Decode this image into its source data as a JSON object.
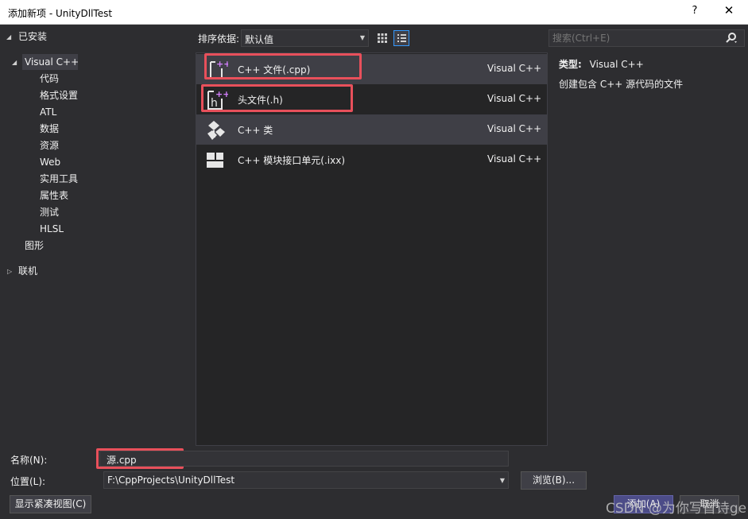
{
  "window": {
    "title": "添加新项 - UnityDllTest",
    "help_label": "?",
    "close_label": "✕"
  },
  "sidebar": {
    "installed_label": "已安装",
    "visual_cpp_label": "Visual C++",
    "children": [
      "代码",
      "格式设置",
      "ATL",
      "数据",
      "资源",
      "Web",
      "实用工具",
      "属性表",
      "测试",
      "HLSL"
    ],
    "graphics_label": "图形",
    "online_label": "联机"
  },
  "toolbar": {
    "sort_label": "排序依据:",
    "sort_value": "默认值"
  },
  "templates": [
    {
      "label": "C++ 文件(.cpp)",
      "lang": "Visual C++",
      "icon": "cpp-file-icon"
    },
    {
      "label": "头文件(.h)",
      "lang": "Visual C++",
      "icon": "header-file-icon"
    },
    {
      "label": "C++ 类",
      "lang": "Visual C++",
      "icon": "cpp-class-icon"
    },
    {
      "label": "C++ 模块接口单元(.ixx)",
      "lang": "Visual C++",
      "icon": "module-interface-icon"
    }
  ],
  "search": {
    "placeholder": "搜索(Ctrl+E)"
  },
  "info": {
    "type_label": "类型:",
    "type_value": "Visual C++",
    "description": "创建包含 C++ 源代码的文件"
  },
  "form": {
    "name_label": "名称(N):",
    "name_value": "源.cpp",
    "location_label": "位置(L):",
    "location_value": "F:\\CppProjects\\UnityDllTest",
    "browse_label": "浏览(B)...",
    "compact_view_label": "显示紧凑视图(C)",
    "add_label": "添加(A)",
    "cancel_label": "取消"
  },
  "watermark": "CSDN @为你写首诗ge",
  "colors": {
    "background": "#2d2d30",
    "panel": "#252526",
    "selected": "#3f3f46",
    "highlight_border": "#e8505b",
    "accent": "#3399ff"
  }
}
